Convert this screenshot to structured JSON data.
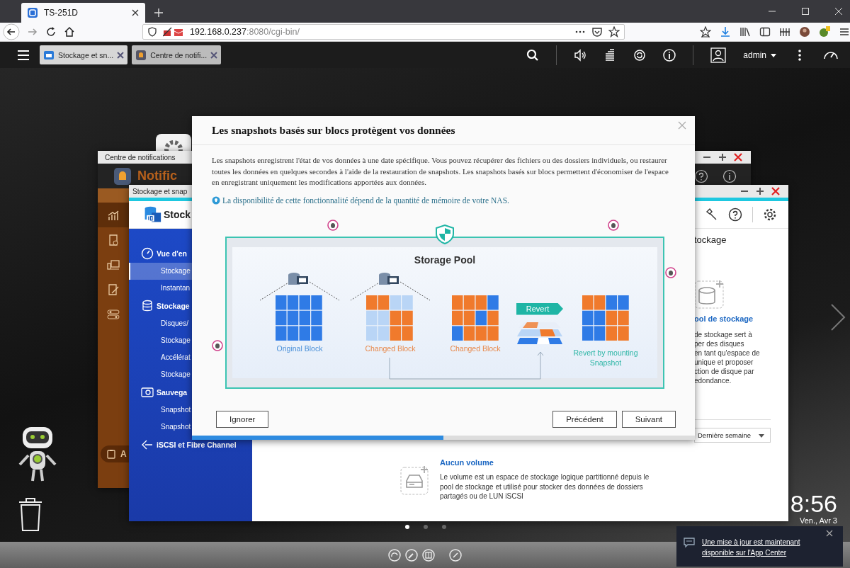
{
  "browser": {
    "tab_title": "TS-251D",
    "url_host": "192.168.0.237",
    "url_rest": ":8080/cgi-bin/"
  },
  "top_bar": {
    "tabs": [
      {
        "label": "Stockage et sn...",
        "kind": "storage"
      },
      {
        "label": "Centre de notifi...",
        "kind": "notify"
      }
    ],
    "user": "admin"
  },
  "notification_window": {
    "title": "Centre de notifications",
    "header": "Notific",
    "sidebar_button": "A"
  },
  "storage_window": {
    "title": "Stockage et snap",
    "header": "Stock",
    "nav": [
      {
        "label": "Vue d'en",
        "kind": "overview",
        "children": [
          {
            "label": "Stockage",
            "selected": true
          },
          {
            "label": "Instantan",
            "selected": false
          }
        ]
      },
      {
        "label": "Stockage",
        "kind": "storage",
        "children": [
          {
            "label": "Disques/",
            "selected": false
          },
          {
            "label": "Stockage",
            "selected": false
          },
          {
            "label": "Accélérat",
            "selected": false
          },
          {
            "label": "Stockage",
            "selected": false
          }
        ]
      },
      {
        "label": "Sauvega",
        "kind": "backup",
        "children": [
          {
            "label": "Snapshot",
            "selected": false
          },
          {
            "label": "Snapshot",
            "selected": false
          }
        ]
      },
      {
        "label": "iSCSI et Fibre Channel",
        "kind": "iscsi"
      }
    ],
    "pool": {
      "title": "tockage",
      "link": "ool de stockage",
      "lines": [
        "de stockage sert à",
        "per des disques",
        "en tant qu'espace de",
        "unique et proposer",
        "ction de disque par",
        "edondance."
      ]
    },
    "period": "Dernière semaine",
    "volume": {
      "title": "Aucun volume",
      "text": "Le volume est un espace de stockage logique partitionné depuis le pool de stockage et utilisé pour stocker des données de dossiers partagés ou de LUN iSCSI"
    }
  },
  "modal": {
    "title": "Les snapshots basés sur blocs protègent vos données",
    "text": "Les snapshots enregistrent l'état de vos données à une date spécifique. Vous pouvez récupérer des fichiers ou des dossiers individuels, ou restaurer toutes les données en quelques secondes à l'aide de la restauration de snapshots. Les snapshots basés sur blocs permettent d'économiser de l'espace en enregistrant uniquement les modifications apportées aux données.",
    "note": "La disponibilité de cette fonctionnalité dépend de la quantité de mémoire de votre NAS.",
    "diagram": {
      "title": "Storage Pool",
      "blocks": [
        {
          "label": "Original Block",
          "kind": "original"
        },
        {
          "label": "Changed Block",
          "kind": "changed"
        },
        {
          "label": "Changed Block",
          "kind": "changed"
        }
      ],
      "revert": "Revert",
      "result": "Revert by mounting Snapshot"
    },
    "buttons": [
      {
        "label": "Ignorer"
      },
      {
        "label": "Précédent"
      },
      {
        "label": "Suivant"
      }
    ],
    "progress": {
      "level": 0.5
    }
  },
  "desktop": {
    "pages": [
      {
        "selected": true
      },
      {
        "selected": false
      },
      {
        "selected": false
      }
    ],
    "time": "8:56",
    "date": "Ven., Avr 3"
  },
  "toast": {
    "text": "Une mise à jour est maintenant disponible sur l'App Center"
  }
}
